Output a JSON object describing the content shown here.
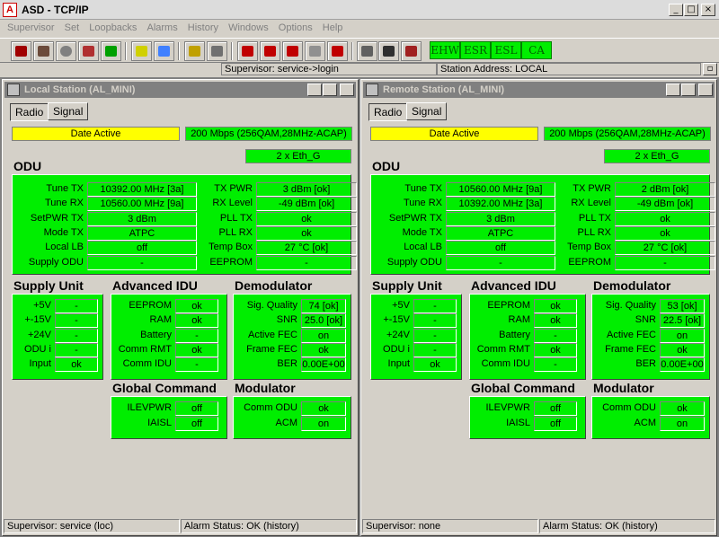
{
  "app": {
    "title": "ASD - TCP/IP",
    "icon_letter": "A"
  },
  "window_buttons": {
    "minimize": "_",
    "maximize": "□",
    "close": "×"
  },
  "menu": [
    "Supervisor",
    "Set",
    "Loopbacks",
    "Alarms",
    "History",
    "Windows",
    "Options",
    "Help"
  ],
  "indicators": [
    "EHW",
    "ESR",
    "ESL",
    "CA"
  ],
  "statusline": {
    "supervisor": "Supervisor: service->login",
    "station": "Station Address: LOCAL"
  },
  "local": {
    "title": "Local Station (AL_MINI)",
    "tabs": [
      "Radio",
      "Signal"
    ],
    "date_active": "Date Active",
    "rate": "200 Mbps (256QAM,28MHz-ACAP)",
    "eth": "2 x Eth_G",
    "odu_title": "ODU",
    "odu_left": [
      {
        "label": "Tune TX",
        "value": "10392.00 MHz  [3a]"
      },
      {
        "label": "Tune RX",
        "value": "10560.00 MHz  [9a]"
      },
      {
        "label": "SetPWR TX",
        "value": "3 dBm"
      },
      {
        "label": "Mode TX",
        "value": "ATPC"
      },
      {
        "label": "Local LB",
        "value": "off"
      },
      {
        "label": "Supply ODU",
        "value": "-"
      }
    ],
    "odu_right": [
      {
        "label": "TX PWR",
        "value": "3 dBm [ok]"
      },
      {
        "label": "RX Level",
        "value": "-49 dBm [ok]"
      },
      {
        "label": "PLL TX",
        "value": "ok"
      },
      {
        "label": "PLL RX",
        "value": "ok"
      },
      {
        "label": "Temp Box",
        "value": "27 °C [ok]"
      },
      {
        "label": "EEPROM",
        "value": "-"
      }
    ],
    "supply_title": "Supply Unit",
    "supply": [
      {
        "label": "+5V",
        "value": "-"
      },
      {
        "label": "+-15V",
        "value": "-"
      },
      {
        "label": "+24V",
        "value": "-"
      },
      {
        "label": "ODU  i",
        "value": "-"
      },
      {
        "label": "Input",
        "value": "ok"
      }
    ],
    "idu_title": "Advanced IDU",
    "idu": [
      {
        "label": "EEPROM",
        "value": "ok"
      },
      {
        "label": "RAM",
        "value": "ok"
      },
      {
        "label": "Battery",
        "value": "-"
      },
      {
        "label": "Comm RMT",
        "value": "ok"
      },
      {
        "label": "Comm IDU",
        "value": "-"
      }
    ],
    "demod_title": "Demodulator",
    "demod": [
      {
        "label": "Sig. Quality",
        "value": "74 [ok]"
      },
      {
        "label": "SNR",
        "value": "25.0 [ok]"
      },
      {
        "label": "Active FEC",
        "value": "on"
      },
      {
        "label": "Frame FEC",
        "value": "ok"
      },
      {
        "label": "BER",
        "value": "0.00E+00"
      }
    ],
    "global_title": "Global Command",
    "global": [
      {
        "label": "ILEVPWR",
        "value": "off"
      },
      {
        "label": "IAISL",
        "value": "off"
      }
    ],
    "mod_title": "Modulator",
    "mod": [
      {
        "label": "Comm ODU",
        "value": "ok"
      },
      {
        "label": "ACM",
        "value": "on"
      }
    ],
    "status_left": "Supervisor: service (loc)",
    "status_right": "Alarm Status: OK (history)"
  },
  "remote": {
    "title": "Remote Station (AL_MINI)",
    "tabs": [
      "Radio",
      "Signal"
    ],
    "date_active": "Date Active",
    "rate": "200 Mbps (256QAM,28MHz-ACAP)",
    "eth": "2 x Eth_G",
    "odu_title": "ODU",
    "odu_left": [
      {
        "label": "Tune TX",
        "value": "10560.00 MHz  [9a]"
      },
      {
        "label": "Tune RX",
        "value": "10392.00 MHz  [3a]"
      },
      {
        "label": "SetPWR TX",
        "value": "3 dBm"
      },
      {
        "label": "Mode TX",
        "value": "ATPC"
      },
      {
        "label": "Local LB",
        "value": "off"
      },
      {
        "label": "Supply ODU",
        "value": "-"
      }
    ],
    "odu_right": [
      {
        "label": "TX PWR",
        "value": "2 dBm [ok]"
      },
      {
        "label": "RX Level",
        "value": "-49 dBm [ok]"
      },
      {
        "label": "PLL TX",
        "value": "ok"
      },
      {
        "label": "PLL RX",
        "value": "ok"
      },
      {
        "label": "Temp Box",
        "value": "27 °C [ok]"
      },
      {
        "label": "EEPROM",
        "value": "-"
      }
    ],
    "supply_title": "Supply Unit",
    "supply": [
      {
        "label": "+5V",
        "value": "-"
      },
      {
        "label": "+-15V",
        "value": "-"
      },
      {
        "label": "+24V",
        "value": "-"
      },
      {
        "label": "ODU  i",
        "value": "-"
      },
      {
        "label": "Input",
        "value": "ok"
      }
    ],
    "idu_title": "Advanced IDU",
    "idu": [
      {
        "label": "EEPROM",
        "value": "ok"
      },
      {
        "label": "RAM",
        "value": "ok"
      },
      {
        "label": "Battery",
        "value": "-"
      },
      {
        "label": "Comm RMT",
        "value": "ok"
      },
      {
        "label": "Comm IDU",
        "value": "-"
      }
    ],
    "demod_title": "Demodulator",
    "demod": [
      {
        "label": "Sig. Quality",
        "value": "53 [ok]"
      },
      {
        "label": "SNR",
        "value": "22.5 [ok]"
      },
      {
        "label": "Active FEC",
        "value": "on"
      },
      {
        "label": "Frame FEC",
        "value": "ok"
      },
      {
        "label": "BER",
        "value": "0.00E+00"
      }
    ],
    "global_title": "Global Command",
    "global": [
      {
        "label": "ILEVPWR",
        "value": "off"
      },
      {
        "label": "IAISL",
        "value": "off"
      }
    ],
    "mod_title": "Modulator",
    "mod": [
      {
        "label": "Comm ODU",
        "value": "ok"
      },
      {
        "label": "ACM",
        "value": "on"
      }
    ],
    "status_left": "Supervisor: none",
    "status_right": "Alarm Status: OK (history)"
  },
  "toolbar_icons": [
    "antenna-icon",
    "tools-icon",
    "stop-icon",
    "printer-icon",
    "tcp-icon",
    "link-icon",
    "link2-icon",
    "wrench-icon",
    "speaker-icon",
    "alarm1-icon",
    "alarm2-icon",
    "alarm3-icon",
    "alarm4-icon",
    "alarm5-icon",
    "scale-icon",
    "grid-icon",
    "chart-icon"
  ],
  "colors": {
    "green": "#00ee00",
    "yellow": "#ffff00",
    "chrome": "#d4d0c8"
  }
}
